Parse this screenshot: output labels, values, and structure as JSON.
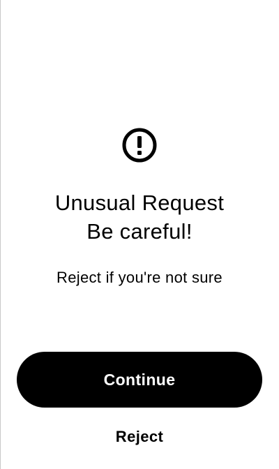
{
  "alert": {
    "icon": "exclamation-circle-icon",
    "title_line1": "Unusual Request",
    "title_line2": "Be careful!",
    "message": "Reject if you're not sure"
  },
  "actions": {
    "continue_label": "Continue",
    "reject_label": "Reject"
  },
  "colors": {
    "background": "#ffffff",
    "primary": "#000000",
    "on_primary": "#ffffff"
  }
}
